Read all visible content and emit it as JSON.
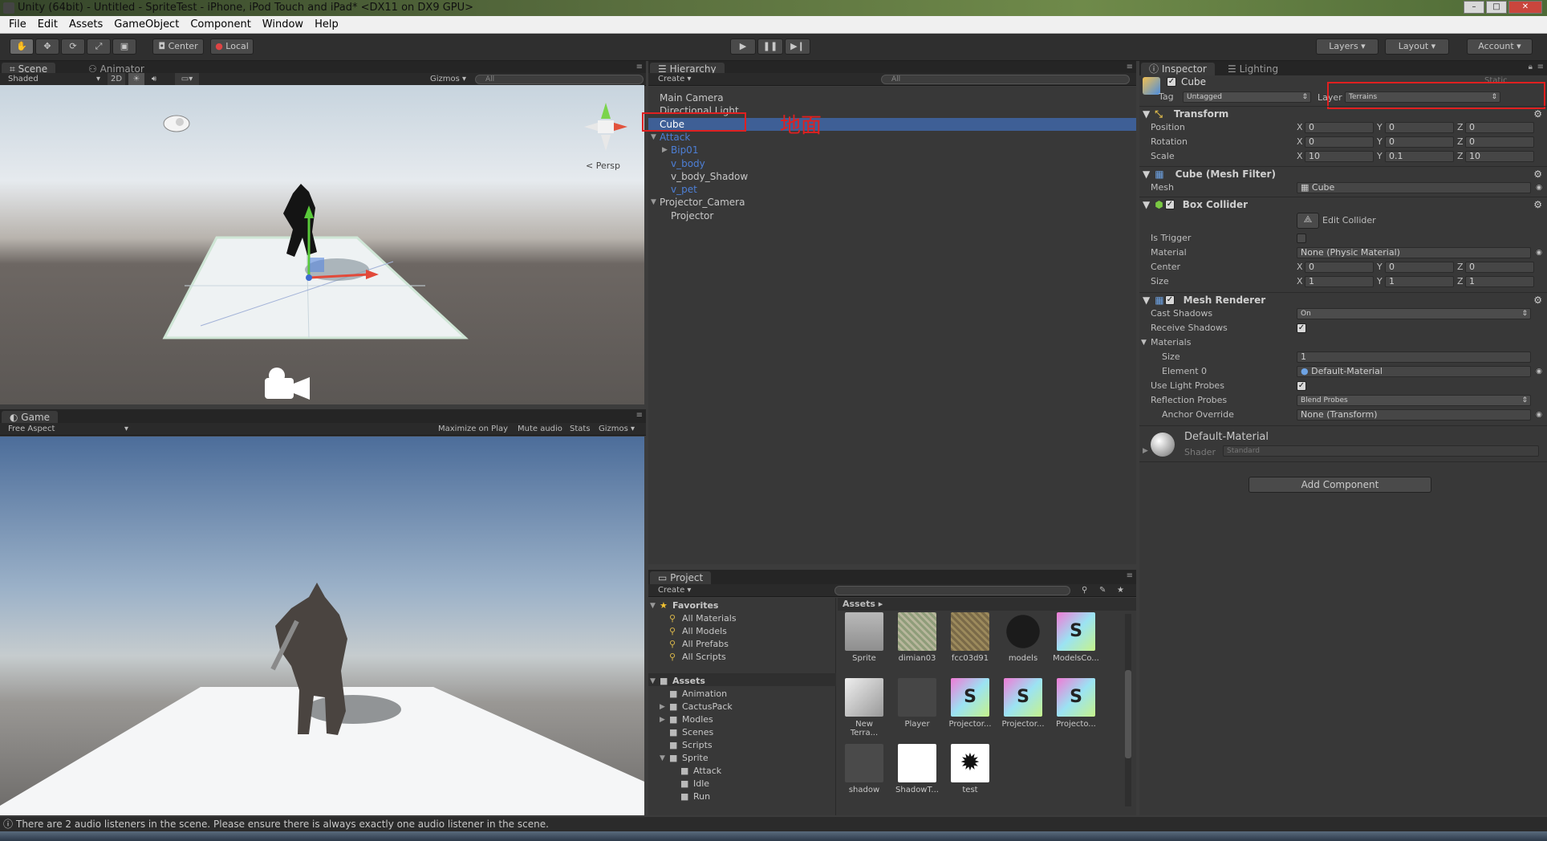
{
  "window": {
    "title": "Unity (64bit) - Untitled - SpriteTest - iPhone, iPod Touch and iPad* <DX11 on DX9 GPU>"
  },
  "menu": [
    "File",
    "Edit",
    "Assets",
    "GameObject",
    "Component",
    "Window",
    "Help"
  ],
  "toolbar": {
    "pivot": "Center",
    "space": "Local",
    "layers": "Layers",
    "layout": "Layout",
    "account": "Account"
  },
  "scene": {
    "tab_scene": "Scene",
    "tab_animator": "Animator",
    "shading": "Shaded",
    "mode_2d": "2D",
    "gizmos": "Gizmos",
    "search": "All",
    "persp": "Persp"
  },
  "game": {
    "tab": "Game",
    "aspect": "Free Aspect",
    "maximize": "Maximize on Play",
    "mute": "Mute audio",
    "stats": "Stats",
    "gizmos": "Gizmos"
  },
  "hierarchy": {
    "tab": "Hierarchy",
    "create": "Create",
    "search": "All",
    "annotation": "地面",
    "items": [
      {
        "label": "Main Camera",
        "indent": 0
      },
      {
        "label": "Directional Light",
        "indent": 0
      },
      {
        "label": "Cube",
        "indent": 0,
        "selected": true
      },
      {
        "label": "Attack",
        "indent": 0,
        "arrow": "▼",
        "prefab": true
      },
      {
        "label": "Bip01",
        "indent": 1,
        "arrow": "▶",
        "prefab": true
      },
      {
        "label": "v_body",
        "indent": 1,
        "prefab": true
      },
      {
        "label": "v_body_Shadow",
        "indent": 1
      },
      {
        "label": "v_pet",
        "indent": 1,
        "prefab": true
      },
      {
        "label": "Projector_Camera",
        "indent": 0,
        "arrow": "▼"
      },
      {
        "label": "Projector",
        "indent": 1
      }
    ]
  },
  "project": {
    "tab": "Project",
    "create": "Create",
    "favorites": "Favorites",
    "fav_items": [
      "All Materials",
      "All Models",
      "All Prefabs",
      "All Scripts"
    ],
    "assets_root": "Assets",
    "folders": [
      "Animation",
      "CactusPack",
      "Modles",
      "Scenes",
      "Scripts",
      "Sprite"
    ],
    "sprite_children": [
      "Attack",
      "Idle",
      "Run"
    ],
    "breadcrumb": "Assets",
    "assets": [
      {
        "name": "Sprite",
        "kind": "folder"
      },
      {
        "name": "dimian03",
        "kind": "texture"
      },
      {
        "name": "fcc03d91",
        "kind": "texture2"
      },
      {
        "name": "models",
        "kind": "sphere"
      },
      {
        "name": "ModelsCo...",
        "kind": "script"
      },
      {
        "name": "New Terra...",
        "kind": "terrain"
      },
      {
        "name": "Player",
        "kind": "prefab"
      },
      {
        "name": "Projector...",
        "kind": "script"
      },
      {
        "name": "Projector...",
        "kind": "script"
      },
      {
        "name": "Projecto...",
        "kind": "script"
      },
      {
        "name": "shadow",
        "kind": "grey"
      },
      {
        "name": "ShadowT...",
        "kind": "white"
      },
      {
        "name": "test",
        "kind": "sprite"
      }
    ]
  },
  "inspector": {
    "tab": "Inspector",
    "tab_lighting": "Lighting",
    "object_name": "Cube",
    "static": "Static",
    "tag_label": "Tag",
    "tag": "Untagged",
    "layer_label": "Layer",
    "layer": "Terrains",
    "transform": {
      "title": "Transform",
      "position_label": "Position",
      "rotation_label": "Rotation",
      "scale_label": "Scale",
      "position": [
        "0",
        "0",
        "0"
      ],
      "rotation": [
        "0",
        "0",
        "0"
      ],
      "scale": [
        "10",
        "0.1",
        "10"
      ]
    },
    "mesh_filter": {
      "title": "Cube (Mesh Filter)",
      "mesh_label": "Mesh",
      "mesh": "Cube"
    },
    "box_collider": {
      "title": "Box Collider",
      "edit": "Edit Collider",
      "is_trigger": "Is Trigger",
      "material_label": "Material",
      "material": "None (Physic Material)",
      "center_label": "Center",
      "center": [
        "0",
        "0",
        "0"
      ],
      "size_label": "Size",
      "size": [
        "1",
        "1",
        "1"
      ]
    },
    "mesh_renderer": {
      "title": "Mesh Renderer",
      "cast_shadows_label": "Cast Shadows",
      "cast_shadows": "On",
      "receive_shadows": "Receive Shadows",
      "materials": "Materials",
      "size_label": "Size",
      "size": "1",
      "element0_label": "Element 0",
      "element0": "Default-Material",
      "light_probes": "Use Light Probes",
      "reflection_label": "Reflection Probes",
      "reflection": "Blend Probes",
      "anchor_label": "Anchor Override",
      "anchor": "None (Transform)"
    },
    "material": {
      "name": "Default-Material",
      "shader_label": "Shader",
      "shader": "Standard"
    },
    "add_component": "Add Component"
  },
  "axes": {
    "x": "X",
    "y": "Y",
    "z": "Z"
  },
  "status": "There are 2 audio listeners in the scene. Please ensure there is always exactly one audio listener in the scene.",
  "colors": {
    "selected": "#3e5f96",
    "annotation_red": "#e02020",
    "prefab_blue": "#4d7fd6"
  }
}
